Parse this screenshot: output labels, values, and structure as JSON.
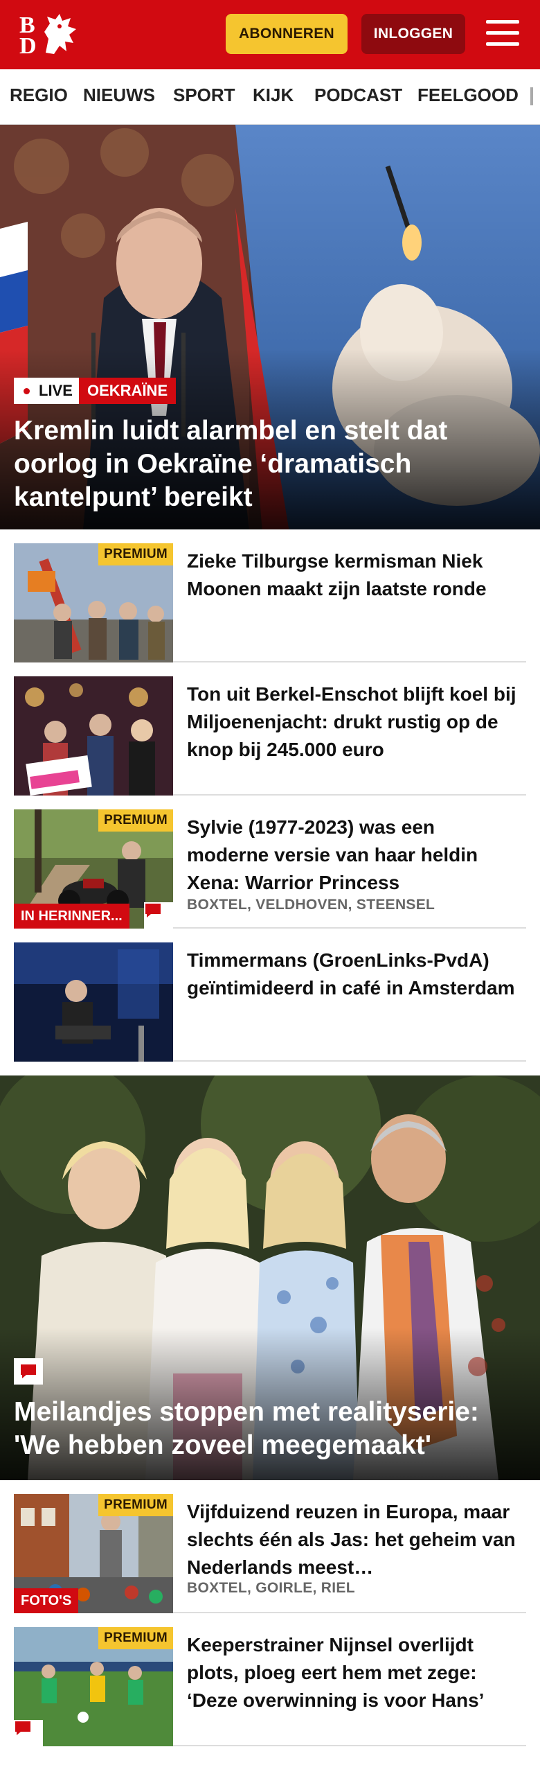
{
  "header": {
    "logo_letters": [
      "B",
      "D"
    ],
    "subscribe_label": "ABONNEREN",
    "login_label": "INLOGGEN",
    "brand_color": "#d10a11",
    "accent_color": "#f5c52f",
    "menu_icon": "hamburger-icon"
  },
  "nav": {
    "items": [
      "REGIO",
      "NIEUWS",
      "SPORT",
      "KIJK",
      "PODCAST",
      "FEELGOOD"
    ]
  },
  "hero": {
    "live_label": "LIVE",
    "topic_label": "OEKRAÏNE",
    "title": "Kremlin luidt alarmbel en stelt dat oorlog in Oekraïne ‘dramatisch kantelpunt’ bereikt"
  },
  "articles": [
    {
      "premium": "PREMIUM",
      "title": "Zieke Tilburgse kermisman Niek Moonen maakt zijn laatste ronde"
    },
    {
      "title": "Ton uit Berkel-Enschot blijft koel bij Miljoenenjacht: drukt rustig op de knop bij 245.000 euro"
    },
    {
      "premium": "PREMIUM",
      "tag": "IN HERINNER...",
      "title": "Sylvie (1977-2023) was een moderne versie van haar heldin Xena: Warrior Princess",
      "locations": "BOXTEL, VELDHOVEN, STEENSEL"
    },
    {
      "title": "Timmermans (GroenLinks-PvdA) geïntimideerd in café in Amsterdam"
    }
  ],
  "feature": {
    "title": "Meilandjes stoppen met realityserie: 'We hebben zoveel meegemaakt'"
  },
  "articles_2": [
    {
      "premium": "PREMIUM",
      "tag": "FOTO'S",
      "title": "Vijfduizend reuzen in Europa, maar slechts één als Jas: het geheim van Nederlands meest…",
      "locations": "BOXTEL, GOIRLE, RIEL"
    },
    {
      "premium": "PREMIUM",
      "title": "Keeperstrainer Nijnsel overlijdt plots, ploeg eert hem met zege: ‘Deze overwinning is voor Hans’"
    }
  ]
}
